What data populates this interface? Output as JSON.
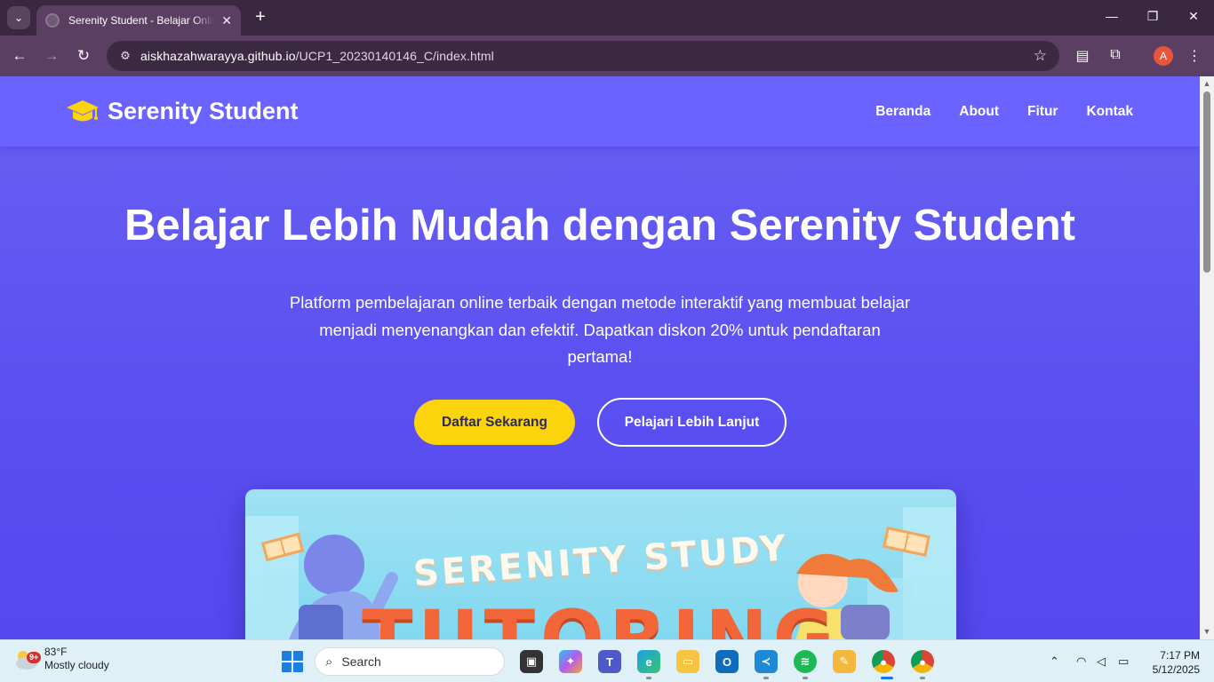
{
  "browser": {
    "tab_title": "Serenity Student - Belajar Online",
    "url_host": "aiskhazahwarayya.github.io",
    "url_path": "/UCP1_20230140146_C/index.html",
    "profile_initial": "A"
  },
  "site": {
    "logo_text": "Serenity Student",
    "nav": [
      "Beranda",
      "About",
      "Fitur",
      "Kontak"
    ],
    "hero_title": "Belajar Lebih Mudah dengan Serenity Student",
    "hero_desc": "Platform pembelajaran online terbaik dengan metode interaktif yang membuat belajar menjadi menyenangkan dan efektif. Dapatkan diskon 20% untuk pendaftaran pertama!",
    "btn_primary": "Daftar Sekarang",
    "btn_secondary": "Pelajari Lebih Lanjut",
    "banner_text_top": "SERENITY STUDY",
    "banner_text_bottom": "TUTORING"
  },
  "taskbar": {
    "weather_temp": "83°F",
    "weather_desc": "Mostly cloudy",
    "weather_badge": "9+",
    "search_placeholder": "Search",
    "time": "7:17 PM",
    "date": "5/12/2025"
  },
  "colors": {
    "header_bg": "#6a63ff",
    "hero_bg": "#5a4ff0",
    "accent_yellow": "#fcd40d"
  }
}
